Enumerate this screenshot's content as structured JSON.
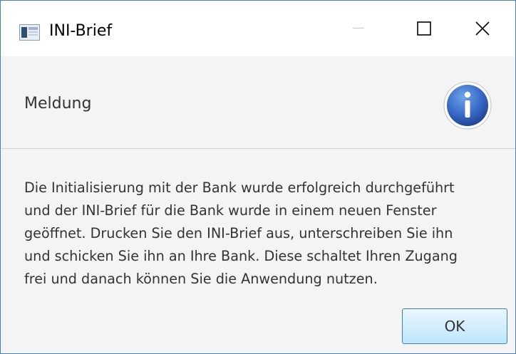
{
  "window": {
    "title": "INI-Brief",
    "controls": {
      "minimize_icon": "minimize-icon",
      "maximize_icon": "maximize-icon",
      "close_icon": "close-icon"
    }
  },
  "dialog": {
    "header": "Meldung",
    "header_icon": "info-icon",
    "message": "Die Initialisierung mit der Bank wurde erfolgreich durchgeführt\nund der INI-Brief für die Bank wurde in einem neuen Fenster\ngeöffnet. Drucken Sie den INI-Brief aus, unterschreiben Sie ihn\nund schicken Sie ihn an Ihre Bank. Diese schaltet Ihren Zugang\nfrei und danach können Sie die Anwendung nutzen.",
    "ok_label": "OK"
  },
  "colors": {
    "accent": "#3a6ec4",
    "window_border": "#4a7fb5",
    "button_border": "#3c7fb1"
  }
}
